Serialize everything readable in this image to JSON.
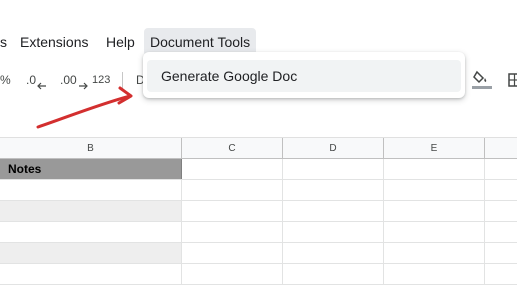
{
  "menubar": {
    "items": [
      {
        "label": "s"
      },
      {
        "label": "Extensions"
      },
      {
        "label": "Help"
      },
      {
        "label": "Document Tools"
      }
    ]
  },
  "toolbar": {
    "percent": "%",
    "decimal_decrease": ".0",
    "decimal_increase": ".00",
    "number_format": "123",
    "font_partial": "D"
  },
  "dropdown": {
    "items": [
      {
        "label": "Generate Google Doc"
      }
    ]
  },
  "sheet": {
    "columns": [
      "B",
      "C",
      "D",
      "E"
    ],
    "header_cell": "Notes"
  },
  "colors": {
    "accent_arrow": "#d32f2f",
    "notes_header_bg": "#999999",
    "alt_row_bg": "#eeeeee"
  }
}
